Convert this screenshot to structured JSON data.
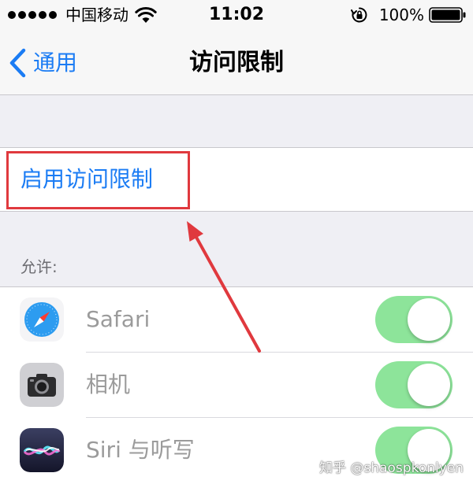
{
  "status_bar": {
    "carrier": "中国移动",
    "time": "11:02",
    "battery": "100%",
    "signal_icon": "signal-dots-icon",
    "wifi_icon": "wifi-icon",
    "rotation_icon": "rotation-lock-icon",
    "battery_icon": "battery-icon"
  },
  "nav": {
    "back_label": "通用",
    "title": "访问限制",
    "back_icon": "chevron-left-icon"
  },
  "enable_restrictions": {
    "label": "启用访问限制"
  },
  "allow_section": {
    "header": "允许:",
    "items": [
      {
        "label": "Safari",
        "icon": "safari-icon",
        "enabled": true
      },
      {
        "label": "相机",
        "icon": "camera-icon",
        "enabled": true
      },
      {
        "label": "Siri 与听写",
        "icon": "siri-icon",
        "enabled": true
      }
    ]
  },
  "watermark": "知乎 @shaospkonlyen",
  "colors": {
    "ios_blue": "#1b7cf4",
    "annotation_red": "#e0393e",
    "toggle_on_disabled": "#8de49a",
    "group_background": "#efeff4"
  }
}
